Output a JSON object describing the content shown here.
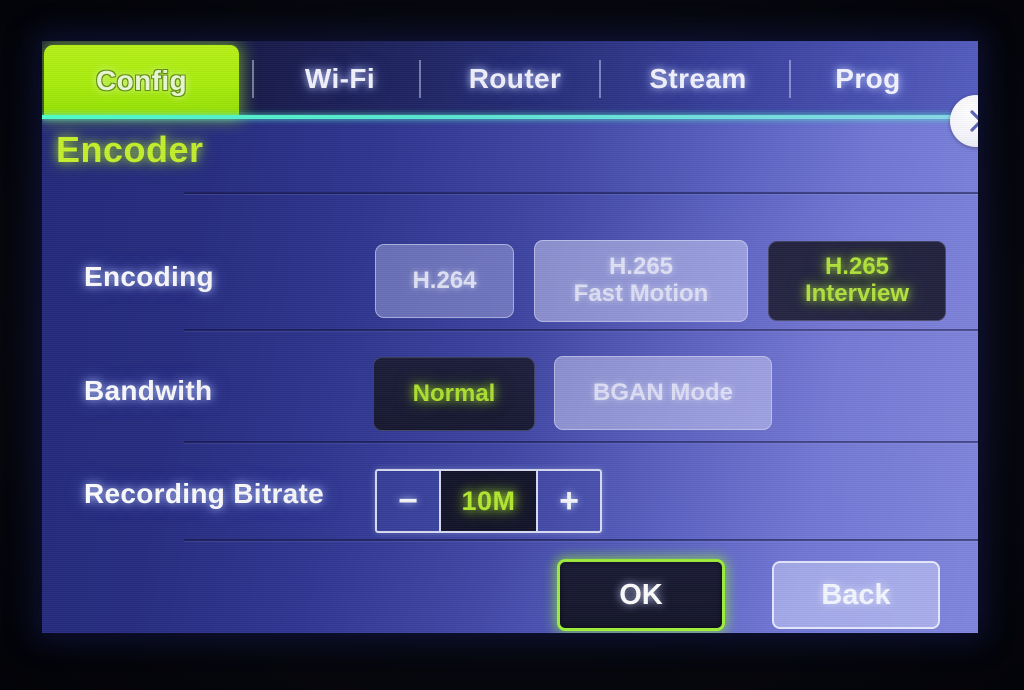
{
  "screen": {
    "accent_green": "#b7ef2b",
    "tab_active_bg": "#a8ec0c",
    "underline_cyan": "#57e7d0",
    "panel_bg_dark": "#23287a",
    "panel_bg_light": "#7f86dd"
  },
  "tabs": [
    {
      "label": "Config",
      "active": true
    },
    {
      "label": "Wi-Fi",
      "active": false
    },
    {
      "label": "Router",
      "active": false
    },
    {
      "label": "Stream",
      "active": false
    },
    {
      "label": "Prog",
      "active": false
    }
  ],
  "tab_overflow": {
    "icon": "chevron-right-icon"
  },
  "section": {
    "title": "Encoder"
  },
  "rows": [
    {
      "label": "Encoding",
      "options": [
        {
          "label": "H.264",
          "line2": "",
          "selected": false
        },
        {
          "label": "H.265",
          "line2": "Fast Motion",
          "selected": false
        },
        {
          "label": "H.265",
          "line2": "Interview",
          "selected": true
        }
      ]
    },
    {
      "label": "Bandwith",
      "options": [
        {
          "label": "Normal",
          "line2": "",
          "selected": true
        },
        {
          "label": "BGAN Mode",
          "line2": "",
          "selected": false
        }
      ]
    },
    {
      "label": "Recording Bitrate",
      "stepper": {
        "decrement": "−",
        "value": "10M",
        "increment": "+"
      }
    }
  ],
  "footer": {
    "ok_label": "OK",
    "back_label": "Back"
  }
}
